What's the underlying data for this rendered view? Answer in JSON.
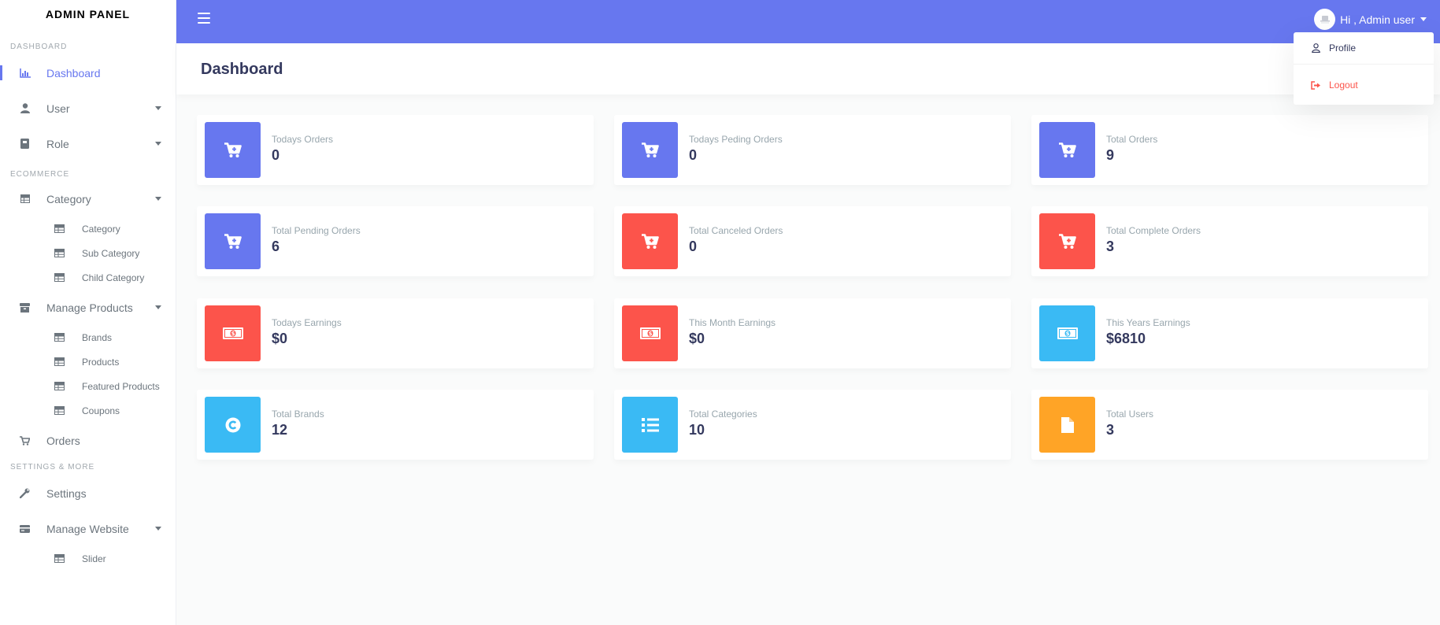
{
  "sidebar": {
    "brand": "ADMIN PANEL",
    "headers": {
      "dashboard": "DASHBOARD",
      "ecommerce": "ECOMMERCE",
      "settings": "SETTINGS & MORE"
    },
    "dashboard": "Dashboard",
    "user": "User",
    "role": "Role",
    "category": "Category",
    "sub_category_list": "Category",
    "sub_category": "Sub Category",
    "child_category": "Child Category",
    "manage_products": "Manage Products",
    "brands": "Brands",
    "products": "Products",
    "featured_products": "Featured Products",
    "coupons": "Coupons",
    "orders": "Orders",
    "settings": "Settings",
    "manage_website": "Manage Website",
    "slider": "Slider"
  },
  "topbar": {
    "greeting": "Hi , Admin user"
  },
  "dropdown": {
    "profile": "Profile",
    "logout": "Logout"
  },
  "page": {
    "title": "Dashboard"
  },
  "stats": [
    {
      "label": "Todays Orders",
      "value": "0",
      "color": "#6777ef",
      "icon": "cart-plus-icon"
    },
    {
      "label": "Todays Peding Orders",
      "value": "0",
      "color": "#6777ef",
      "icon": "cart-plus-icon"
    },
    {
      "label": "Total Orders",
      "value": "9",
      "color": "#6777ef",
      "icon": "cart-plus-icon"
    },
    {
      "label": "Total Pending Orders",
      "value": "6",
      "color": "#6777ef",
      "icon": "cart-plus-icon"
    },
    {
      "label": "Total Canceled Orders",
      "value": "0",
      "color": "#fc544b",
      "icon": "cart-plus-icon"
    },
    {
      "label": "Total Complete Orders",
      "value": "3",
      "color": "#fc544b",
      "icon": "cart-plus-icon"
    },
    {
      "label": "Todays Earnings",
      "value": "$0",
      "color": "#fc544b",
      "icon": "money-bill-icon"
    },
    {
      "label": "This Month Earnings",
      "value": "$0",
      "color": "#fc544b",
      "icon": "money-bill-icon"
    },
    {
      "label": "This Years Earnings",
      "value": "$6810",
      "color": "#3abaf4",
      "icon": "money-bill-icon"
    },
    {
      "label": "Total Brands",
      "value": "12",
      "color": "#3abaf4",
      "icon": "copyright-icon"
    },
    {
      "label": "Total Categories",
      "value": "10",
      "color": "#3abaf4",
      "icon": "list-icon"
    },
    {
      "label": "Total Users",
      "value": "3",
      "color": "#ffa426",
      "icon": "file-icon"
    }
  ]
}
